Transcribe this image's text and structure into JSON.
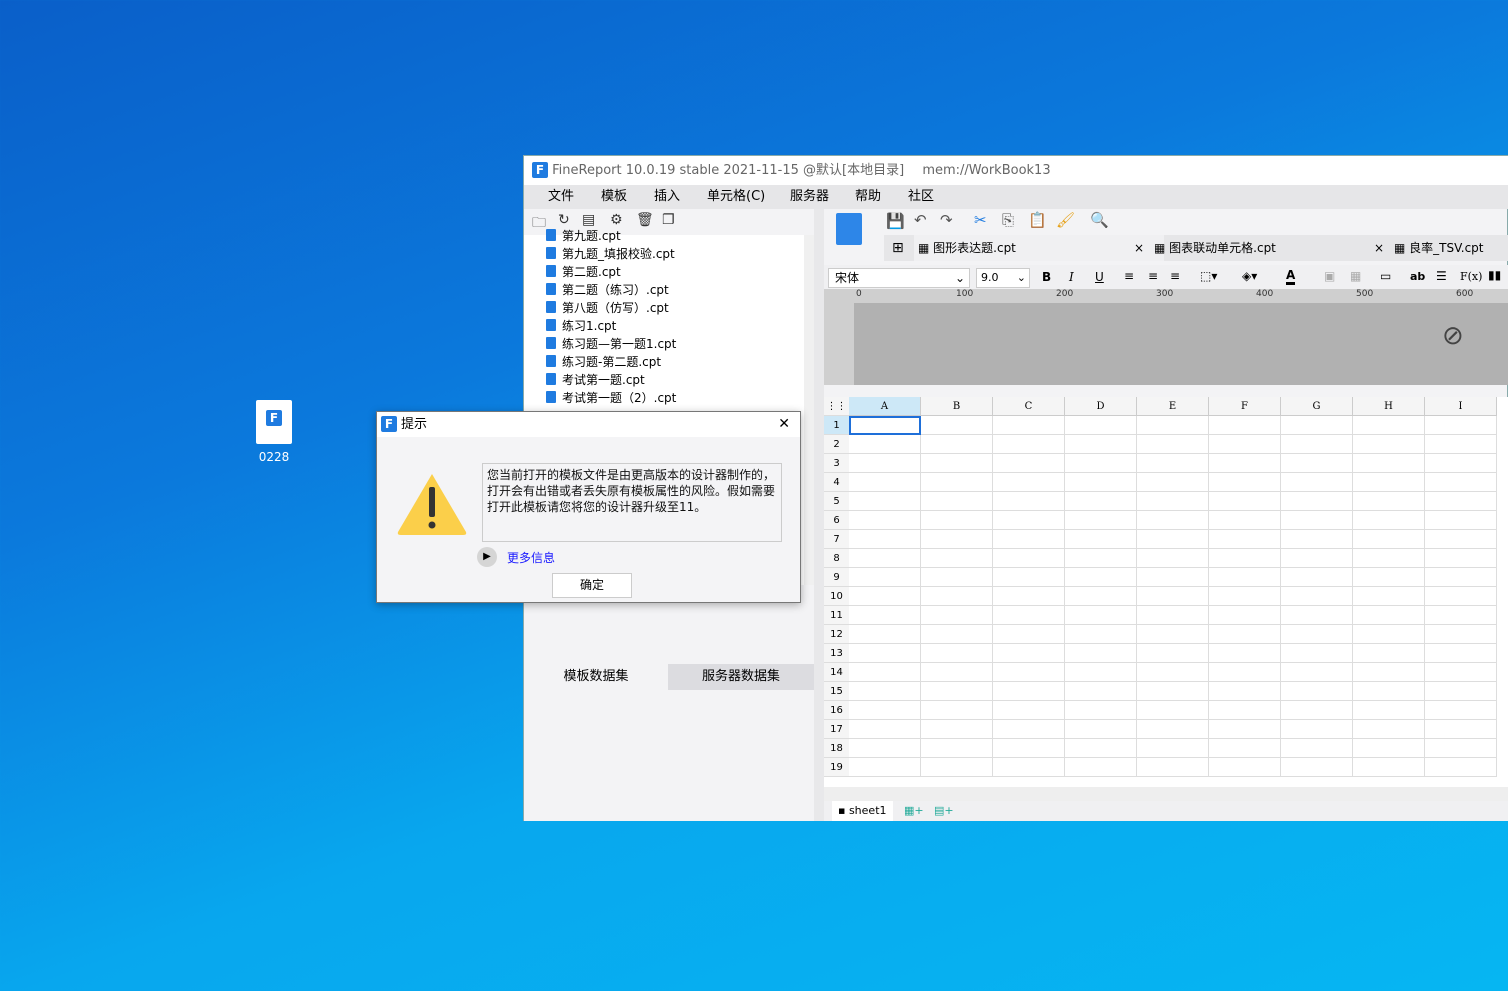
{
  "desktop": {
    "icon_label": "0228"
  },
  "window": {
    "title": "FineReport 10.0.19 stable 2021-11-15 @默认[本地目录]",
    "workbook": "mem://WorkBook13"
  },
  "menu": [
    "文件",
    "模板",
    "插入",
    "单元格(C)",
    "服务器",
    "帮助",
    "社区"
  ],
  "files": [
    "第九题_填报校验.cpt",
    "第二题.cpt",
    "第二题（练习）.cpt",
    "第八题（仿写）.cpt",
    "练习1.cpt",
    "练习题—第一题1.cpt",
    "练习题-第二题.cpt",
    "考试第一题.cpt",
    "考试第一题（2）.cpt"
  ],
  "file_partial": "第九题.cpt",
  "dataset_tabs": [
    "模板数据集",
    "服务器数据集"
  ],
  "tabs": [
    {
      "label": "图形表达题.cpt",
      "close": "×"
    },
    {
      "label": "图表联动单元格.cpt",
      "close": "×"
    },
    {
      "label": "良率_TSV.cpt"
    }
  ],
  "format": {
    "font": "宋体",
    "size": "9.0",
    "bold": "B",
    "italic": "I",
    "underline": "U",
    "ab": "ab",
    "fx": "F(x)"
  },
  "ruler": [
    "0",
    "100",
    "200",
    "300",
    "400",
    "500",
    "600"
  ],
  "columns": [
    "A",
    "B",
    "C",
    "D",
    "E",
    "F",
    "G",
    "H",
    "I"
  ],
  "rows": [
    "1",
    "2",
    "3",
    "4",
    "5",
    "6",
    "7",
    "8",
    "9",
    "10",
    "11",
    "12",
    "13",
    "14",
    "15",
    "16",
    "17",
    "18",
    "19"
  ],
  "sheet": {
    "name": "sheet1"
  },
  "dialog": {
    "title": "提示",
    "message": "您当前打开的模板文件是由更高版本的设计器制作的，打开会有出错或者丢失原有模板属性的风险。假如需要打开此模板请您将您的设计器升级至11。",
    "more_info": "更多信息",
    "ok": "确定",
    "close": "✕"
  },
  "colors": {
    "accent": "#1f7be0",
    "selection": "#1e6fd9",
    "link": "#1a1aff",
    "warning": "#f9c940"
  }
}
